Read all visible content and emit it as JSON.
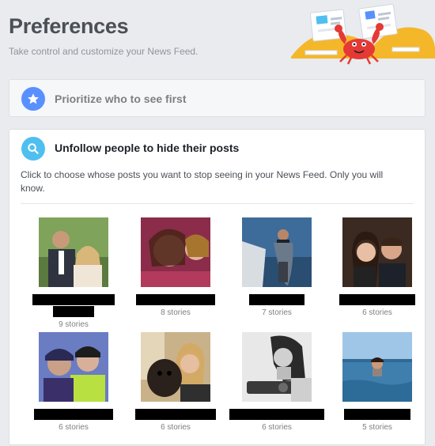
{
  "header": {
    "title": "Preferences",
    "subtitle": "Take control and customize your News Feed."
  },
  "prioritize": {
    "label": "Prioritize who to see first",
    "icon": "star-icon",
    "icon_color": "#5890ff"
  },
  "unfollow": {
    "label": "Unfollow people to hide their posts",
    "icon": "search-icon",
    "icon_color": "#4fbfef",
    "description": "Click to choose whose posts you want to stop seeing in your News Feed. Only you will know."
  },
  "people": [
    {
      "stories": "9 stories"
    },
    {
      "stories": "8 stories"
    },
    {
      "stories": "7 stories"
    },
    {
      "stories": "6 stories"
    },
    {
      "stories": "6 stories"
    },
    {
      "stories": "6 stories"
    },
    {
      "stories": "6 stories"
    },
    {
      "stories": "5 stories"
    }
  ],
  "colors": {
    "background": "#e9ebee",
    "crab": "#e53935",
    "sand": "#f5b72a"
  }
}
